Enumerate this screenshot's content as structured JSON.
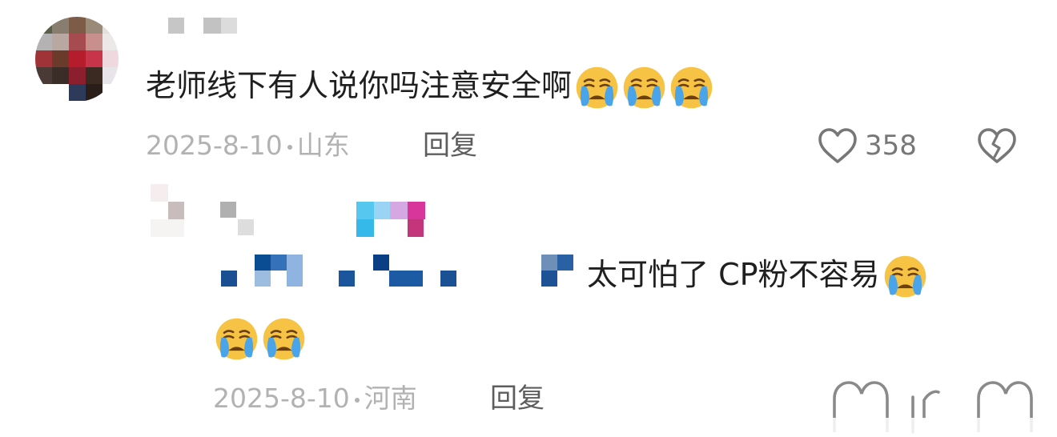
{
  "comment": {
    "text": "老师线下有人说你吗注意安全啊",
    "emojis": [
      "crying-face",
      "crying-face",
      "crying-face"
    ],
    "date": "2025-8-10",
    "location": "山东",
    "reply_label": "回复",
    "likes": "358"
  },
  "reply": {
    "text": "太可怕了 CP粉不容易",
    "emojis": [
      "crying-face",
      "crying-face",
      "crying-face"
    ],
    "date": "2025-8-10",
    "location": "河南",
    "reply_label": "回复"
  },
  "colors": {
    "text": "#1f1f1f",
    "meta": "#b2b2b2",
    "reply": "#5d5d5d",
    "icon": "#777777",
    "emoji_face": "#f6c344",
    "emoji_tear": "#4aa4ea"
  },
  "icons": [
    "heart-outline-icon",
    "broken-heart-icon",
    "crying-face-emoji"
  ]
}
